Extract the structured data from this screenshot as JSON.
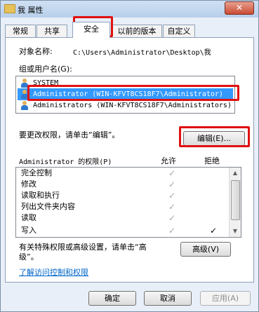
{
  "window": {
    "title": "我 属性",
    "close_label": "✕"
  },
  "tabs": [
    {
      "label": "常规"
    },
    {
      "label": "共享"
    },
    {
      "label": "安全"
    },
    {
      "label": "以前的版本"
    },
    {
      "label": "自定义"
    }
  ],
  "security": {
    "object_label": "对象名称:",
    "object_value": "C:\\Users\\Administrator\\Desktop\\我",
    "group_label": "组或用户名(G):",
    "users": [
      {
        "name": "SYSTEM"
      },
      {
        "name": "Administrator (WIN-KFVT8CS18F7\\Administrator)"
      },
      {
        "name": "Administrators (WIN-KFVT8CS18F7\\Administrators)"
      }
    ],
    "change_hint": "要更改权限，请单击“编辑”。",
    "edit_button": "编辑(E)...",
    "perm_title": "Administrator 的权限(P)",
    "allow_header": "允许",
    "deny_header": "拒绝",
    "permissions": [
      {
        "name": "完全控制",
        "allow": "✓",
        "deny": ""
      },
      {
        "name": "修改",
        "allow": "✓",
        "deny": ""
      },
      {
        "name": "读取和执行",
        "allow": "✓",
        "deny": ""
      },
      {
        "name": "列出文件夹内容",
        "allow": "✓",
        "deny": ""
      },
      {
        "name": "读取",
        "allow": "✓",
        "deny": ""
      },
      {
        "name": "写入",
        "allow": "✓",
        "deny": "✓"
      }
    ],
    "special_hint_1": "有关特殊权限或高级设置，请单击“高",
    "special_hint_2": "级”。",
    "advanced_button": "高级(V)",
    "learn_link": "了解访问控制和权限"
  },
  "footer": {
    "ok": "确定",
    "cancel": "取消",
    "apply": "应用(A)"
  }
}
